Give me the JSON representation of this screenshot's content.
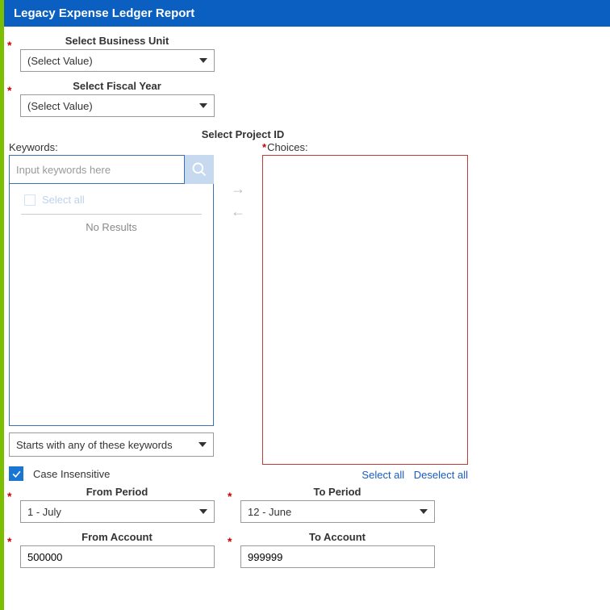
{
  "title": "Legacy Expense Ledger Report",
  "businessUnit": {
    "label": "Select Business Unit",
    "value": "(Select Value)"
  },
  "fiscalYear": {
    "label": "Select Fiscal Year",
    "value": "(Select Value)"
  },
  "projectId": {
    "label": "Select Project ID",
    "keywordsLabel": "Keywords:",
    "keywordsPlaceholder": "Input keywords here",
    "selectAll": "Select all",
    "noResults": "No Results",
    "matchMode": "Starts with any of these keywords",
    "caseInsensitive": "Case Insensitive",
    "choicesLabel": "Choices:",
    "linkSelectAll": "Select all",
    "linkDeselectAll": "Deselect all"
  },
  "fromPeriod": {
    "label": "From Period",
    "value": "1 - July"
  },
  "toPeriod": {
    "label": "To Period",
    "value": "12 - June"
  },
  "fromAccount": {
    "label": "From Account",
    "value": "500000"
  },
  "toAccount": {
    "label": "To Account",
    "value": "999999"
  }
}
